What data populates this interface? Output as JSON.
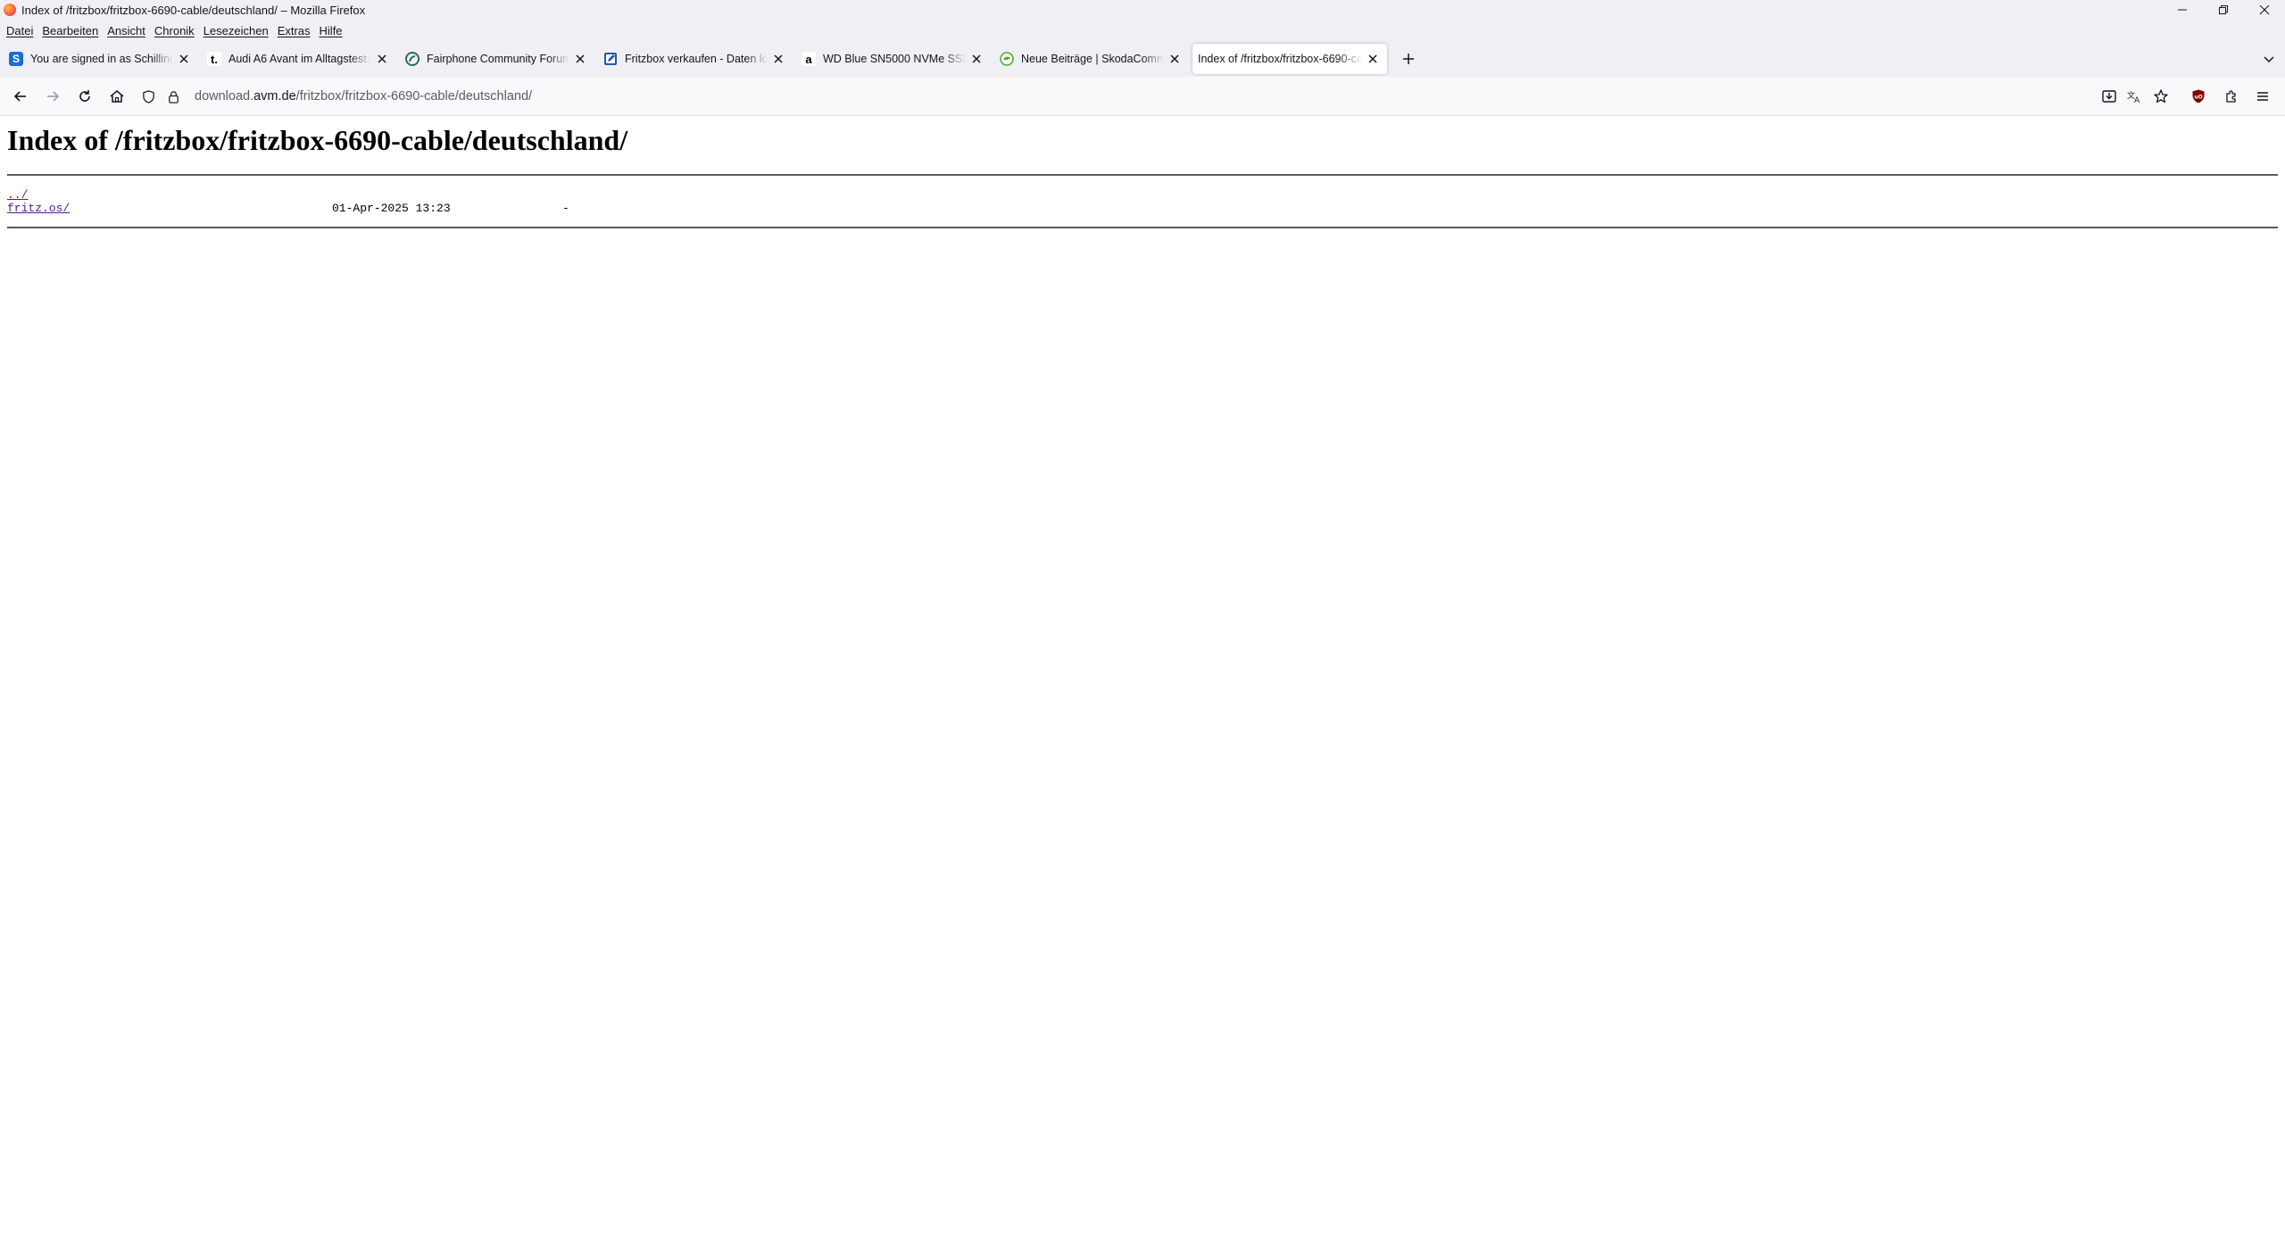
{
  "window": {
    "title": "Index of /fritzbox/fritzbox-6690-cable/deutschland/ – Mozilla Firefox"
  },
  "menu": [
    "Datei",
    "Bearbeiten",
    "Ansicht",
    "Chronik",
    "Lesezeichen",
    "Extras",
    "Hilfe"
  ],
  "tabs": [
    {
      "label": "You are signed in as Schillings",
      "favicon": "S",
      "favicon_color": "#1a6fd4",
      "active": false
    },
    {
      "label": "Audi A6 Avant im Alltagstest: Ein",
      "favicon": "t.",
      "favicon_color": "#ffffff",
      "active": false
    },
    {
      "label": "Fairphone Community Forum",
      "favicon": "fairphone-icon",
      "favicon_color": "#2e6b5a",
      "active": false
    },
    {
      "label": "Fritzbox verkaufen - Daten lösche",
      "favicon": "edit-icon",
      "favicon_color": "#1e5aa8",
      "active": false
    },
    {
      "label": "WD Blue SN5000 NVMe SSD 2 TB",
      "favicon": "a",
      "favicon_color": "#ffffff",
      "active": false
    },
    {
      "label": "Neue Beiträge | SkodaCommunity",
      "favicon": "skoda-icon",
      "favicon_color": "#4ba82e",
      "active": false
    },
    {
      "label": "Index of /fritzbox/fritzbox-6690-cable",
      "favicon": "",
      "favicon_color": "",
      "active": true
    }
  ],
  "navbar": {
    "url_prefix": "download.",
    "url_host": "avm.de",
    "url_path": "/fritzbox/fritzbox-6690-cable/deutschland/"
  },
  "page": {
    "title": "Index of /fritzbox/fritzbox-6690-cable/deutschland/",
    "entries": [
      {
        "name": "../",
        "date": "",
        "size": ""
      },
      {
        "name": "fritz.os/",
        "date": "01-Apr-2025 13:23",
        "size": "-"
      }
    ]
  }
}
